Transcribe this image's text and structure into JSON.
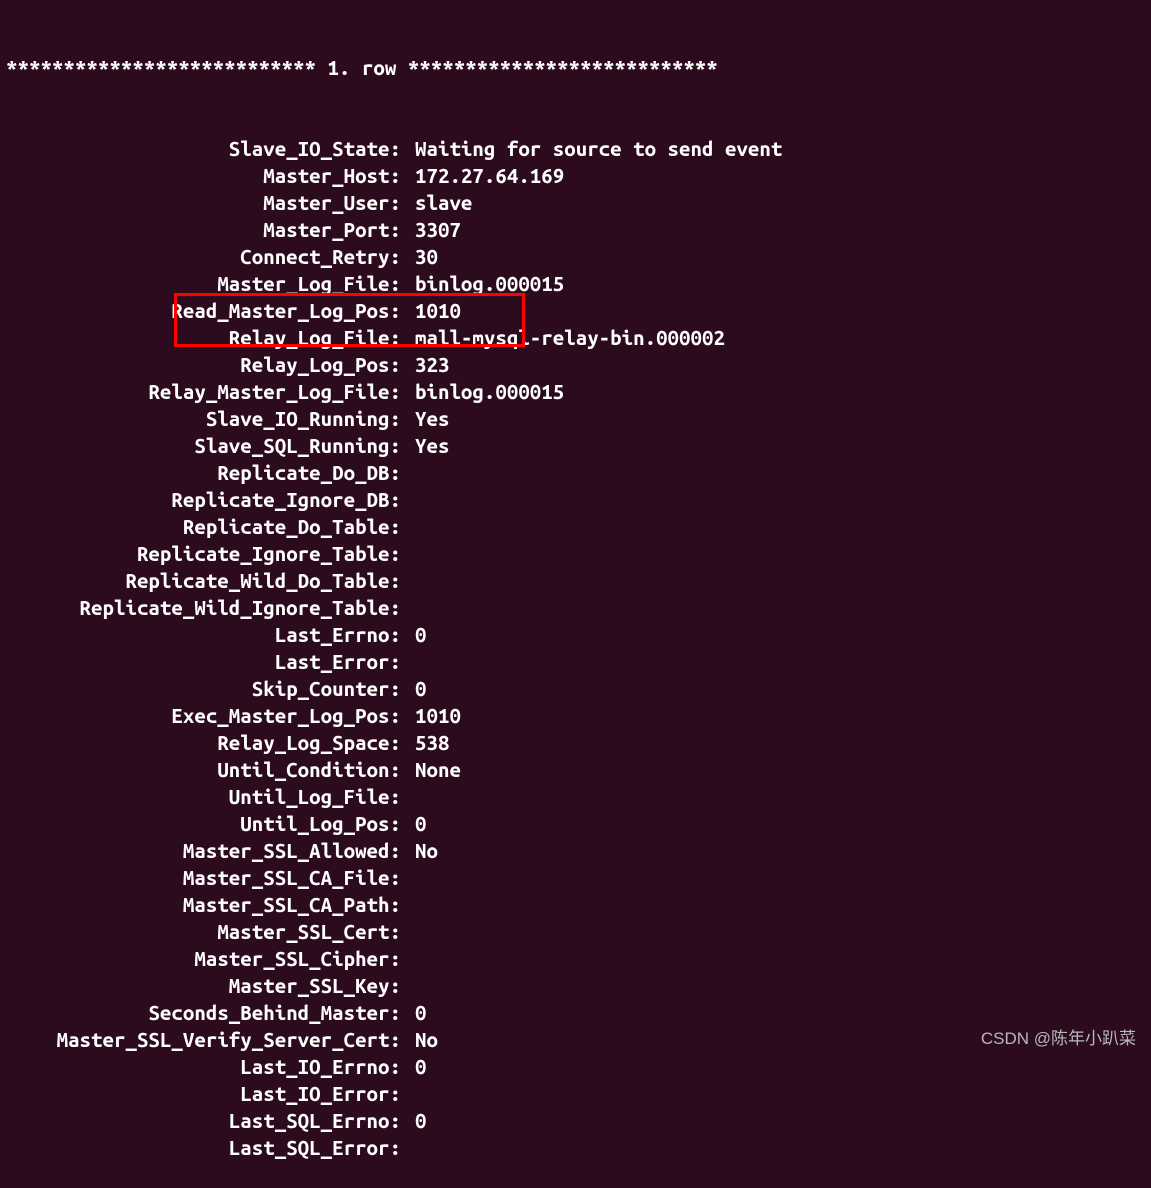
{
  "header": "*************************** 1. row ***************************",
  "rows": [
    {
      "label": "Slave_IO_State:",
      "value": "Waiting for source to send event"
    },
    {
      "label": "Master_Host:",
      "value": "172.27.64.169"
    },
    {
      "label": "Master_User:",
      "value": "slave"
    },
    {
      "label": "Master_Port:",
      "value": "3307"
    },
    {
      "label": "Connect_Retry:",
      "value": "30"
    },
    {
      "label": "Master_Log_File:",
      "value": "binlog.000015"
    },
    {
      "label": "Read_Master_Log_Pos:",
      "value": "1010"
    },
    {
      "label": "Relay_Log_File:",
      "value": "mall-mysql-relay-bin.000002"
    },
    {
      "label": "Relay_Log_Pos:",
      "value": "323"
    },
    {
      "label": "Relay_Master_Log_File:",
      "value": "binlog.000015"
    },
    {
      "label": "Slave_IO_Running:",
      "value": "Yes"
    },
    {
      "label": "Slave_SQL_Running:",
      "value": "Yes"
    },
    {
      "label": "Replicate_Do_DB:",
      "value": ""
    },
    {
      "label": "Replicate_Ignore_DB:",
      "value": ""
    },
    {
      "label": "Replicate_Do_Table:",
      "value": ""
    },
    {
      "label": "Replicate_Ignore_Table:",
      "value": ""
    },
    {
      "label": "Replicate_Wild_Do_Table:",
      "value": ""
    },
    {
      "label": "Replicate_Wild_Ignore_Table:",
      "value": ""
    },
    {
      "label": "Last_Errno:",
      "value": "0"
    },
    {
      "label": "Last_Error:",
      "value": ""
    },
    {
      "label": "Skip_Counter:",
      "value": "0"
    },
    {
      "label": "Exec_Master_Log_Pos:",
      "value": "1010"
    },
    {
      "label": "Relay_Log_Space:",
      "value": "538"
    },
    {
      "label": "Until_Condition:",
      "value": "None"
    },
    {
      "label": "Until_Log_File:",
      "value": ""
    },
    {
      "label": "Until_Log_Pos:",
      "value": "0"
    },
    {
      "label": "Master_SSL_Allowed:",
      "value": "No"
    },
    {
      "label": "Master_SSL_CA_File:",
      "value": ""
    },
    {
      "label": "Master_SSL_CA_Path:",
      "value": ""
    },
    {
      "label": "Master_SSL_Cert:",
      "value": ""
    },
    {
      "label": "Master_SSL_Cipher:",
      "value": ""
    },
    {
      "label": "Master_SSL_Key:",
      "value": ""
    },
    {
      "label": "Seconds_Behind_Master:",
      "value": "0"
    },
    {
      "label": "Master_SSL_Verify_Server_Cert:",
      "value": "No"
    },
    {
      "label": "Last_IO_Errno:",
      "value": "0"
    },
    {
      "label": "Last_IO_Error:",
      "value": ""
    },
    {
      "label": "Last_SQL_Errno:",
      "value": "0"
    },
    {
      "label": "Last_SQL_Error:",
      "value": ""
    }
  ],
  "watermark": "CSDN @陈年小趴菜"
}
